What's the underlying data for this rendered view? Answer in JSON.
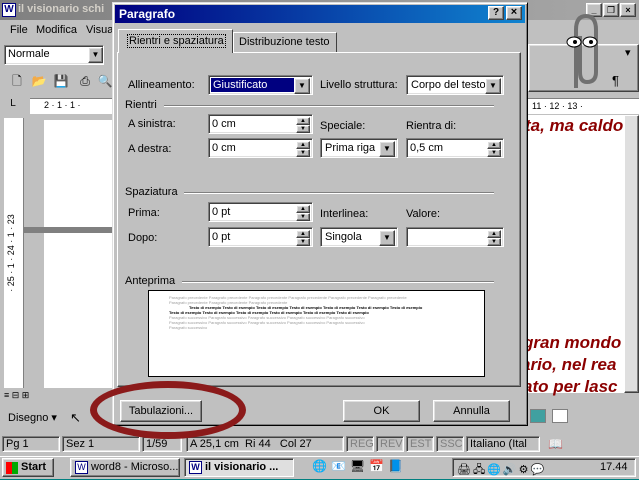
{
  "word": {
    "title": "il visionario schi",
    "menus": [
      "File",
      "Modifica",
      "Visua"
    ],
    "style_value": "Normale",
    "ruler_numbers_h": "11 · 12 · 13 ·",
    "ruler_numbers_v": "· 25 · 1 · 24 · 1 · 23",
    "doc_lines": [
      "ta, ma caldo",
      "gran mondo",
      "ario, nel rea",
      "ato per lasc"
    ],
    "draw_label": "Disegno",
    "status": {
      "pg": "Pg 1",
      "sez": "Sez 1",
      "pages": "1/59",
      "pos": "A 25,1 cm",
      "ri": "Ri 44",
      "col": "Col 27",
      "reg": "REG",
      "rev": "REV",
      "est": "EST",
      "ssc": "SSC",
      "lang": "Italiano (Ital"
    }
  },
  "taskbar": {
    "start": "Start",
    "tasks": [
      "word8 - Microso...",
      "il visionario ..."
    ],
    "clock": "17.44"
  },
  "dialog": {
    "title": "Paragrafo",
    "help": "?",
    "close": "×",
    "tabs": [
      "Rientri e spaziatura",
      "Distribuzione testo"
    ],
    "allineamento_label": "Allineamento:",
    "allineamento_value": "Giustificato",
    "livello_label": "Livello struttura:",
    "livello_value": "Corpo del testo",
    "rientri_group": "Rientri",
    "sinistra_label": "A sinistra:",
    "sinistra_value": "0 cm",
    "destra_label": "A destra:",
    "destra_value": "0 cm",
    "speciale_label": "Speciale:",
    "speciale_value": "Prima riga",
    "rientra_label": "Rientra di:",
    "rientra_value": "0,5 cm",
    "spaziatura_group": "Spaziatura",
    "prima_label": "Prima:",
    "prima_value": "0 pt",
    "dopo_label": "Dopo:",
    "dopo_value": "0 pt",
    "interlinea_label": "Interlinea:",
    "interlinea_value": "Singola",
    "valore_label": "Valore:",
    "valore_value": "",
    "anteprima_group": "Anteprima",
    "preview_lines": [
      "Paragrafo precedente Paragrafo precedente Paragrafo precedente Paragrafo precedente Paragrafo precedente Paragrafo precedente",
      "Paragrafo precedente Paragrafo precedente Paragrafo precedente",
      "Testo di esempio Testo di esempio Testo di esempio Testo di esempio Testo di esempio Testo di esempio Testo di esempio",
      "Testo di esempio Testo di esempio Testo di esempio Testo di esempio Testo di esempio Testo di esempio",
      "Paragrafo successivo Paragrafo successivo Paragrafo successivo Paragrafo successivo Paragrafo successivo",
      "Paragrafo successivo Paragrafo successivo Paragrafo successivo Paragrafo successivo Paragrafo successivo",
      "Paragrafo successivo"
    ],
    "tabulazioni_button": "Tabulazioni...",
    "ok_button": "OK",
    "annulla_button": "Annulla"
  },
  "colors": {
    "titlebar_active": "#000080",
    "doc_text": "#8b0000",
    "annotation": "#8b1a1a"
  }
}
